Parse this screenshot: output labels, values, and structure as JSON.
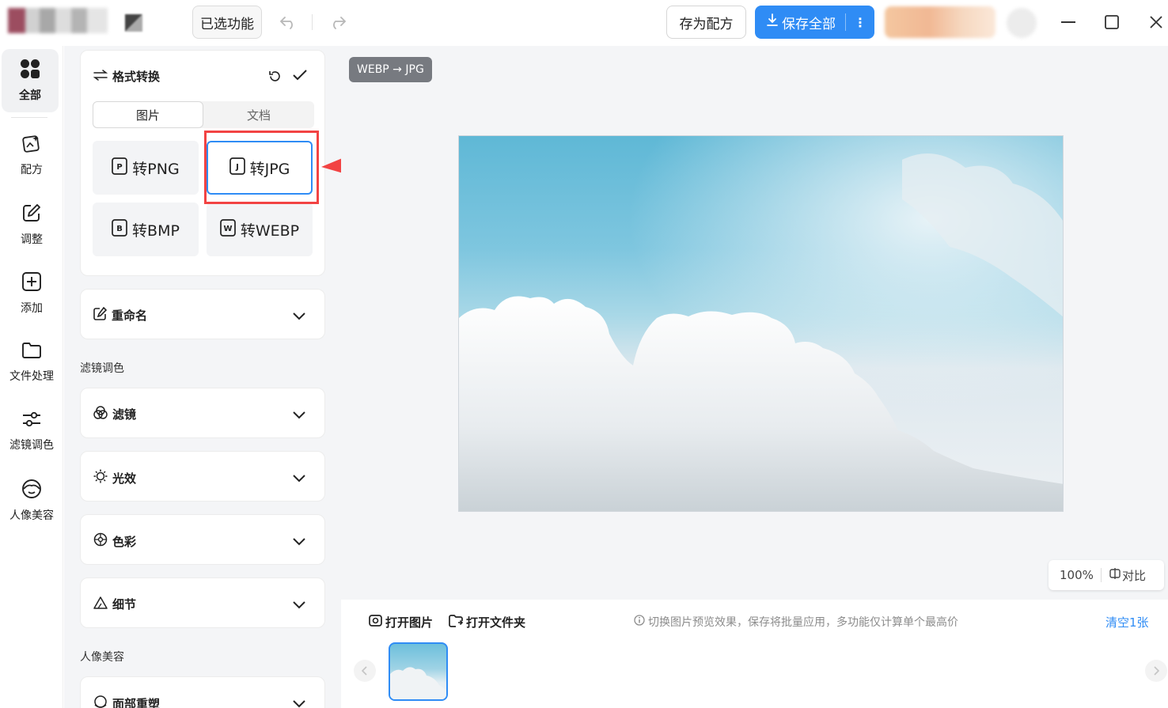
{
  "toolbar": {
    "selected_functions": "已选功能",
    "save_recipe": "存为配方",
    "save_all": "保存全部"
  },
  "nav": {
    "items": [
      {
        "label": "全部",
        "icon": "grid-icon"
      },
      {
        "label": "配方",
        "icon": "recipe-icon"
      },
      {
        "label": "调整",
        "icon": "edit-icon"
      },
      {
        "label": "添加",
        "icon": "add-icon"
      },
      {
        "label": "文件处理",
        "icon": "folder-icon"
      },
      {
        "label": "滤镜调色",
        "icon": "sliders-icon"
      },
      {
        "label": "人像美容",
        "icon": "face-icon"
      }
    ]
  },
  "format": {
    "title": "格式转换",
    "tabs": [
      "图片",
      "文档"
    ],
    "buttons": [
      "转PNG",
      "转JPG",
      "转BMP",
      "转WEBP"
    ],
    "selected": "转JPG"
  },
  "sections": {
    "rename": "重命名",
    "filter_group": "滤镜调色",
    "filter": "滤镜",
    "light": "光效",
    "color": "色彩",
    "detail": "细节",
    "portrait_group": "人像美容",
    "face_reshape": "面部重塑"
  },
  "preview": {
    "badge": "WEBP → JPG",
    "zoom": "100%",
    "compare": "对比"
  },
  "bottom": {
    "open_image": "打开图片",
    "open_folder": "打开文件夹",
    "hint": "切换图片预览效果，保存将批量应用，多功能仅计算单个最高价",
    "clear": "清空1张"
  },
  "colors": {
    "accent": "#2f8cf5",
    "annotation": "#f24343",
    "panel_bg": "#f4f5f7"
  }
}
